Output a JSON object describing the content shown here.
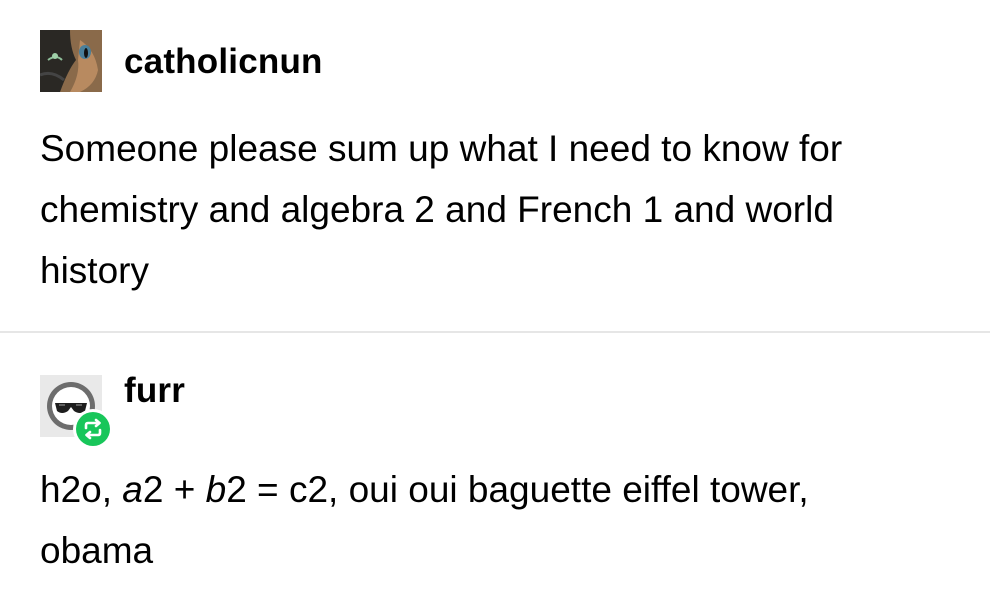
{
  "posts": [
    {
      "username": "catholicnun",
      "avatar": "cat-photo",
      "text_lines": [
        "Someone please sum up what I need to know for",
        "chemistry and algebra 2 and French 1 and world",
        "history"
      ]
    },
    {
      "username": "furr",
      "avatar": "sunglasses-face",
      "badge_icon": "reblog-icon",
      "badge_color": "#18c65a",
      "text": {
        "p1": "h2o, ",
        "a": "a",
        "p2": "2 + ",
        "b": "b",
        "p3": "2 = c2, oui oui baguette eiffel tower,",
        "line2": "obama"
      }
    }
  ]
}
